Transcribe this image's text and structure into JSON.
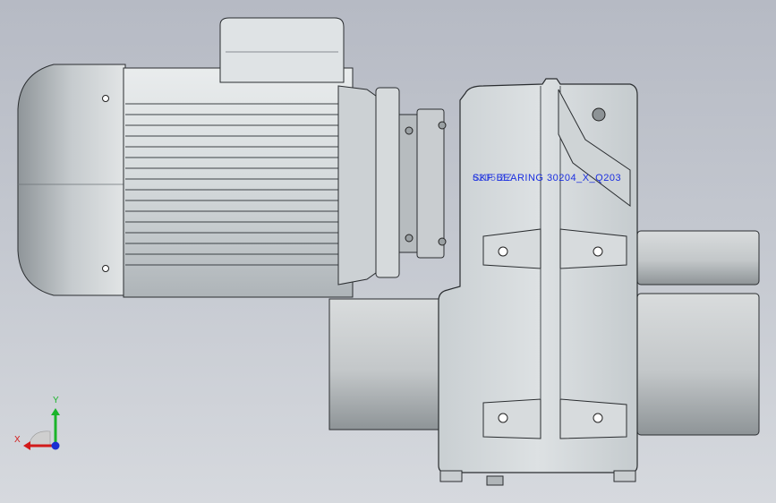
{
  "viewport": {
    "background_top": "#b6bac4",
    "background_bottom": "#d6d9de"
  },
  "model": {
    "description_icons": [
      "motor",
      "terminal-box",
      "flange",
      "gearbox-housing",
      "output-shaft",
      "hollow-shaft"
    ],
    "body_color": "#d4d9dc",
    "outline_color": "#2a2d30"
  },
  "annotations": {
    "overlay_text_a": "SKF BEARING  30204_X_Q203",
    "overlay_text_b": "6205 ZZ",
    "overlay_color": "#1a2ee0"
  },
  "triad": {
    "x_label": "X",
    "y_label": "Y",
    "x_color": "#d21a1a",
    "y_color": "#1ab42a",
    "z_color": "#1a2ed2"
  }
}
